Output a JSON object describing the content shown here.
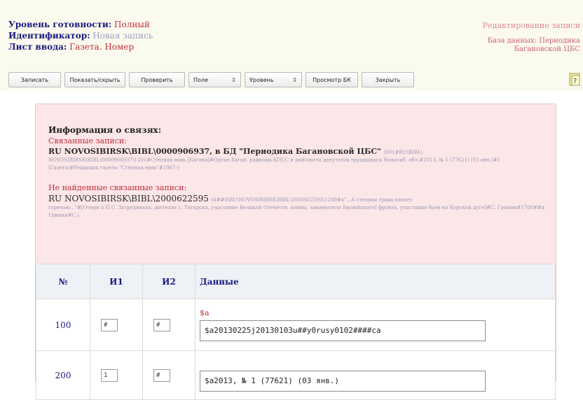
{
  "header": {
    "level_label": "Уровень готовности:",
    "level_value": "Полный",
    "id_label": "Идентификатор:",
    "id_value": "Новая запись",
    "sheet_label": "Лист ввода:",
    "sheet_value": "Газета. Номер",
    "edit_title": "Редактирование записи",
    "db_line1": "База данных: Периодика",
    "db_line2": "Багановской ЦБС"
  },
  "toolbar": {
    "save": "Записать",
    "show": "Показать/скрыть",
    "check": "Проверить",
    "fields": "Поле",
    "level": "Уровень",
    "view_bk": "Просмотр БК",
    "close": "Закрыть"
  },
  "links": {
    "heading": "Информация о связях:",
    "related_label": "Связанные записи:",
    "related_record": "RU NOVOSIBIRSK\\BIBL\\0000906937, в БД \"Периодика Багановской ЦБС\"",
    "related_faint_tail": "(001#RU\\BIBL\\",
    "related_faint": "NOVOSIBIRSK\\BIBL\\0000906937\\1201#Степная новь [Багана]#Орган Баган. райкома КПСС и райсовета депутатов трудящихся Новосиб. обл.#2013, № 1 (77621) (03 янв.)#1 (Газета)#Редакция газеты \"Степная новь\"#1967-)",
    "notfound_label": "Не найденные связанные записи:",
    "notfound_record": "RU NOVOSIBIRSK\\BIBL\\2000622595",
    "notfound_faint_tail": "(4##0\\RU\\NOVOSIBIRSK\\BIBL\\2000622595\\1200#a\"...А степная трава пахнет",
    "notfound_faint": "горечью...\"#[Очерк о П.С. Затрудниках, жителях с. Татарска, участнике Великой Отечеств. войны, завоевателе Вилюйского] фронта, участнике боев на Курской дуге]#С. Гринин#1700##а Гринин#С.)"
  },
  "table": {
    "col_num": "№",
    "col_i1": "И1",
    "col_i2": "И2",
    "col_data": "Данные",
    "rows": [
      {
        "tag": "100",
        "i1": "#",
        "i2": "#",
        "sub": "$a",
        "data": "$a20130225j20130103u##y0rusy0102####ca"
      },
      {
        "tag": "200",
        "i1": "1",
        "i2": "#",
        "sub": "",
        "data": "$a2013, № 1 (77621) (03 янв.)"
      }
    ]
  }
}
